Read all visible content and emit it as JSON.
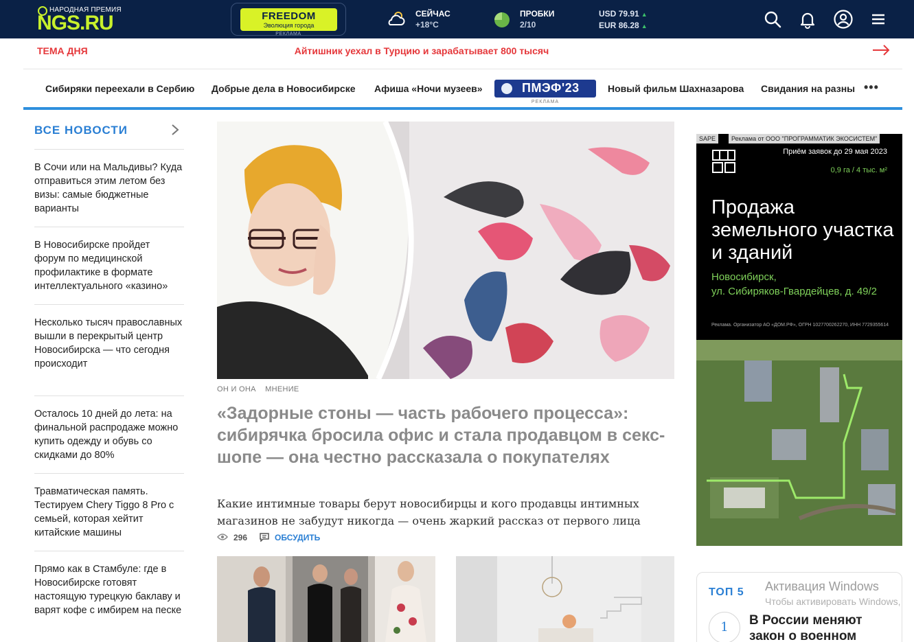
{
  "header": {
    "award_label": "НАРОДНАЯ ПРЕМИЯ",
    "site_name": "NGS.RU",
    "promo": {
      "title": "FREEDOM",
      "subtitle": "Эволюция города",
      "ad_label": "РЕКЛАМА"
    },
    "weather": {
      "label": "СЕЙЧАС",
      "value": "+18°C",
      "icon": "partly-cloudy-icon"
    },
    "traffic": {
      "label": "ПРОБКИ",
      "value": "2/10",
      "color": "#6ab547"
    },
    "currency": [
      {
        "code": "USD",
        "value": "79.91",
        "trend": "▲"
      },
      {
        "code": "EUR",
        "value": "86.28",
        "trend": "▲"
      }
    ],
    "icons": [
      "search-icon",
      "bell-icon",
      "user-icon",
      "menu-icon"
    ],
    "colors": {
      "background": "#0a2146",
      "accent": "#c8f02c"
    }
  },
  "theme_day": {
    "label": "ТЕМА ДНЯ",
    "headline": "Айтишник уехал в Турцию и зарабатывает 800 тысяч",
    "color": "#e5383b"
  },
  "nav": {
    "items": [
      "Сибиряки переехали в Сербию",
      "Добрые дела в Новосибирске",
      "Афиша «Ночи музеев»",
      "Новый фильм Шахназарова",
      "Свидания на разны"
    ],
    "promo": {
      "label": "ПМЭФ'23",
      "ad_label": "РЕКЛАМА"
    },
    "more": "•••"
  },
  "sidebar": {
    "title": "ВСЕ НОВОСТИ",
    "items": [
      "В Сочи или на Мальдивы? Куда отправиться этим летом без визы: самые бюджетные варианты",
      "В Новосибирске пройдет форум по медицинской профилактике в формате интеллектуального «казино»",
      "Несколько тысяч православных вышли в перекрытый центр Новосибирска — что сегодня происходит",
      "Осталось 10 дней до лета: на финальной распродаже можно купить одежду и обувь со скидками до 80%",
      "Травматическая память. Тестируем Chery Tiggo 8 Pro с семьей, которая хейтит китайские машины",
      "Прямо как в Стамбуле: где в Новосибирске готовят настоящую турецкую баклаву и варят кофе с имбирем на песке"
    ]
  },
  "main": {
    "tags": [
      "ОН И ОНА",
      "МНЕНИЕ"
    ],
    "title": "«Задорные стоны — часть рабочего процесса»: сибирячка бросила офис и стала продавцом в секс-шопе — она честно рассказала о покупателях",
    "lead": "Какие интимные товары берут новосибирцы и кого продавцы интимных магазинов не забудут никогда — очень жаркий рассказ от первого лица",
    "views": "296",
    "discuss": "ОБСУДИТЬ"
  },
  "ad": {
    "network": "SAPE",
    "advertiser": "Реклама от ООО \"ПРОГРАММАТИК ЭКОСИСТЕМ\"",
    "date": "Приём заявок до 29 мая 2023",
    "area": "0,9 га / 4 тыс. м²",
    "title": "Продажа земельного участка и зданий",
    "city": "Новосибирск,",
    "address": "ул. Сибиряков-Гвардейцев, д. 49/2",
    "legal": "Реклама. Организатор АО «ДОМ.РФ», ОГРН 1027700262270, ИНН 7729355614"
  },
  "top5": {
    "title": "ТОП 5",
    "first_number": "1",
    "first_headline": "В России меняют закон о военном"
  },
  "watermark": {
    "line1": "Активация Windows",
    "line2": "Чтобы активировать Windows,"
  }
}
